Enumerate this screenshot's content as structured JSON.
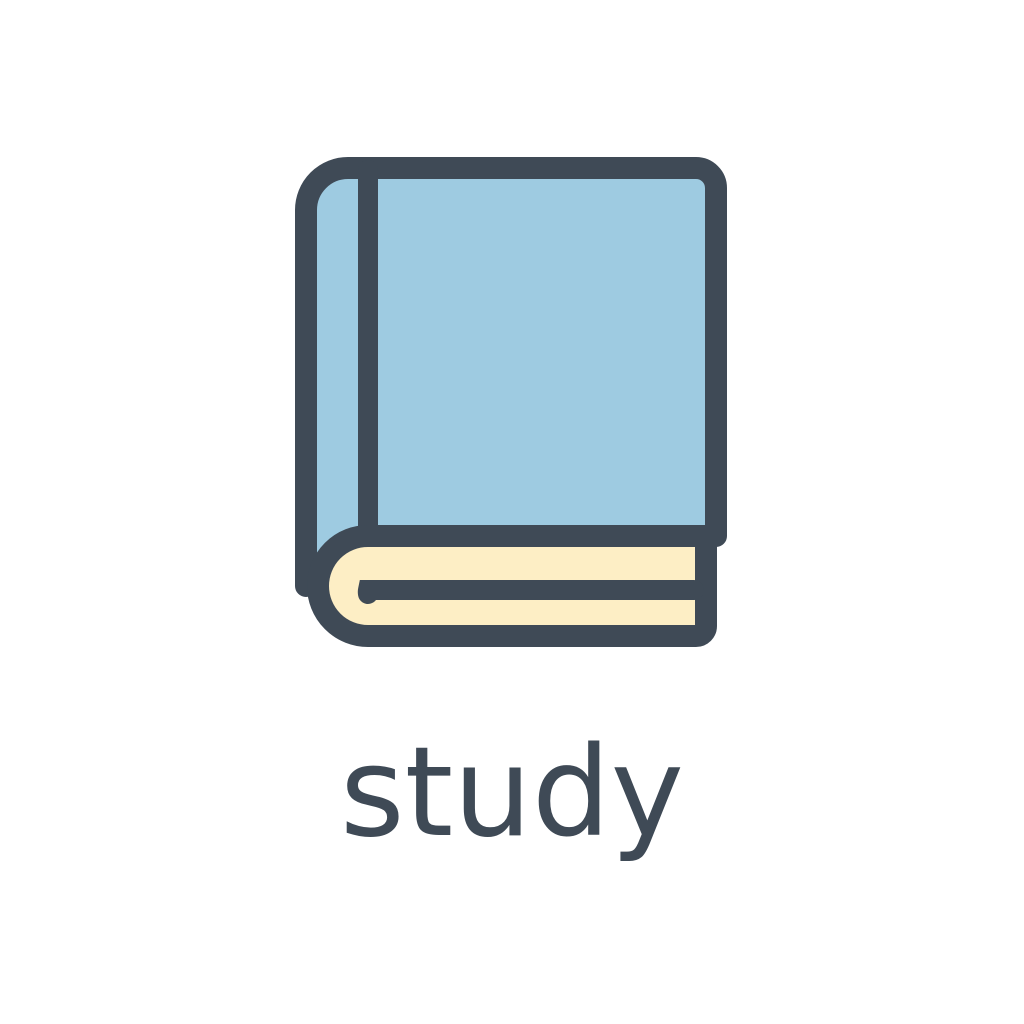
{
  "icon": {
    "name": "book-icon",
    "colors": {
      "outline": "#3f4a56",
      "cover": "#9ecbe1",
      "pages": "#fdeec5",
      "background": "#ffffff"
    }
  },
  "caption": {
    "text": "study"
  }
}
